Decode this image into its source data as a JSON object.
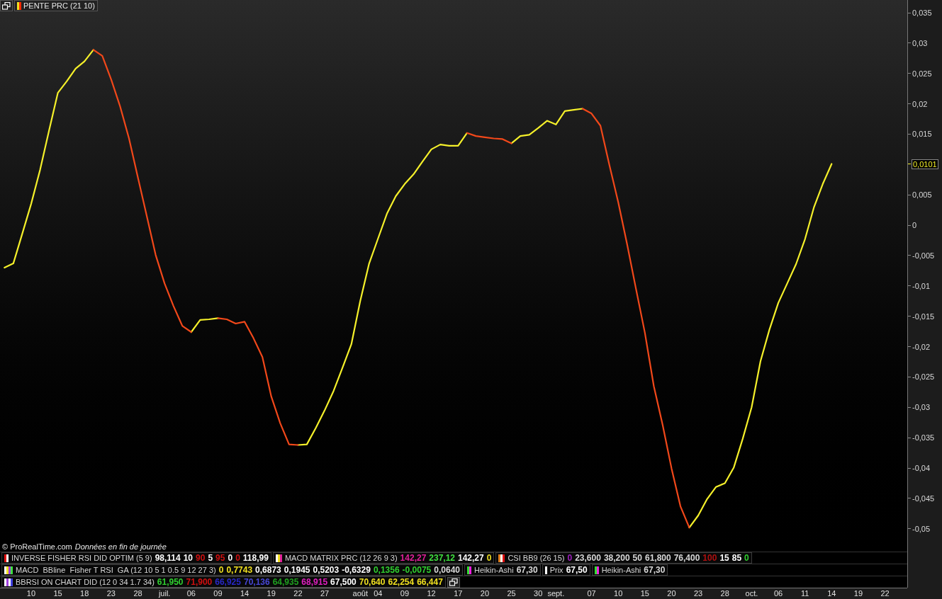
{
  "header": {
    "title": "PENTE PRC (21 10)",
    "stripes": [
      {
        "color": "#f0e020"
      },
      {
        "color": "#ff2a00"
      }
    ]
  },
  "chart_data": {
    "type": "line",
    "ylim": [
      -0.0597,
      0.0371
    ],
    "categories": [
      null,
      null,
      null,
      "10",
      null,
      null,
      "15",
      null,
      null,
      "18",
      null,
      null,
      "23",
      null,
      null,
      "28",
      null,
      null,
      "juil.",
      null,
      null,
      "06",
      null,
      null,
      "09",
      null,
      null,
      "14",
      null,
      null,
      "19",
      null,
      null,
      "22",
      null,
      null,
      "27",
      null,
      null,
      null,
      "août",
      null,
      "04",
      null,
      null,
      "09",
      null,
      null,
      "12",
      null,
      null,
      "17",
      null,
      null,
      "20",
      null,
      null,
      "25",
      null,
      null,
      "30",
      null,
      "sept.",
      null,
      null,
      null,
      "07",
      null,
      null,
      "10",
      null,
      null,
      "15",
      null,
      null,
      "20",
      null,
      null,
      "23",
      null,
      null,
      "28",
      null,
      null,
      "oct.",
      null,
      null,
      "06",
      null,
      null,
      "11",
      null,
      null,
      "14",
      null,
      null,
      "19",
      null,
      null,
      "22",
      null,
      null
    ],
    "series": [
      {
        "color": "#f5f02a",
        "values": [
          -0.007,
          -0.0063,
          -0.0014,
          0.0035,
          0.0091,
          0.0155,
          0.0218,
          0.0237,
          0.0258,
          0.027,
          0.0289,
          null,
          null,
          null,
          null,
          null,
          null,
          null,
          null,
          null,
          null,
          -0.0176,
          -0.0156,
          -0.0155,
          -0.0153,
          null,
          null,
          null,
          null,
          null,
          null,
          null,
          null,
          -0.0362,
          -0.0361,
          -0.0334,
          -0.0305,
          -0.0273,
          -0.0235,
          -0.0196,
          -0.0125,
          -0.0063,
          -0.0022,
          0.0019,
          0.0048,
          0.0068,
          0.0084,
          0.0105,
          0.0125,
          0.0133,
          0.0131,
          0.0131,
          0.0152,
          null,
          null,
          null,
          null,
          0.0135,
          0.0147,
          0.0149,
          0.016,
          0.0172,
          0.0166,
          0.0188,
          0.019,
          0.0192,
          null,
          null,
          null,
          null,
          null,
          null,
          null,
          null,
          null,
          null,
          null,
          -0.0498,
          -0.0478,
          -0.0451,
          -0.0431,
          -0.0425,
          -0.0399,
          -0.0352,
          -0.03,
          -0.0224,
          -0.0172,
          -0.0128,
          -0.0096,
          -0.0064,
          -0.0023,
          0.0029,
          0.0068,
          0.0101,
          null,
          null,
          null,
          null,
          null,
          null,
          null,
          null
        ]
      },
      {
        "color": "#f2481a",
        "values": [
          null,
          null,
          null,
          null,
          null,
          null,
          null,
          null,
          null,
          null,
          0.0289,
          0.0279,
          0.024,
          0.0196,
          0.0143,
          0.0079,
          0.0015,
          -0.0049,
          -0.0096,
          -0.0133,
          -0.0166,
          -0.0176,
          null,
          null,
          -0.0153,
          -0.0155,
          -0.0162,
          -0.0159,
          -0.0186,
          -0.0217,
          -0.0282,
          -0.0326,
          -0.0361,
          -0.0362,
          null,
          null,
          null,
          null,
          null,
          null,
          null,
          null,
          null,
          null,
          null,
          null,
          null,
          null,
          null,
          null,
          null,
          null,
          0.0152,
          0.0147,
          0.0145,
          0.0143,
          0.0142,
          0.0135,
          null,
          null,
          null,
          null,
          null,
          null,
          null,
          0.0192,
          0.0184,
          0.0164,
          0.01,
          0.0038,
          -0.0031,
          -0.0105,
          -0.0177,
          -0.0265,
          -0.0329,
          -0.0401,
          -0.0463,
          -0.0498,
          null,
          null,
          null,
          null,
          null,
          null,
          null,
          null,
          null,
          null,
          null,
          null,
          null,
          null,
          null,
          null,
          null,
          null,
          null,
          null,
          null,
          null,
          null,
          null
        ]
      }
    ],
    "yticks": [
      {
        "value": 0.035,
        "label": "0,035"
      },
      {
        "value": 0.03,
        "label": "0,03"
      },
      {
        "value": 0.025,
        "label": "0,025"
      },
      {
        "value": 0.02,
        "label": "0,02"
      },
      {
        "value": 0.015,
        "label": "0,015"
      },
      {
        "value": 0.005,
        "label": "0,005"
      },
      {
        "value": 0,
        "label": "0"
      },
      {
        "value": -0.005,
        "label": "-0,005"
      },
      {
        "value": -0.01,
        "label": "-0,01"
      },
      {
        "value": -0.015,
        "label": "-0,015"
      },
      {
        "value": -0.02,
        "label": "-0,02"
      },
      {
        "value": -0.025,
        "label": "-0,025"
      },
      {
        "value": -0.03,
        "label": "-0,03"
      },
      {
        "value": -0.035,
        "label": "-0,035"
      },
      {
        "value": -0.04,
        "label": "-0,04"
      },
      {
        "value": -0.045,
        "label": "-0,045"
      },
      {
        "value": -0.05,
        "label": "-0,05"
      }
    ]
  },
  "current_value_tag": "0,0101",
  "source": {
    "copyright": "© ProRealTime.com",
    "note": "Données en fin de journée"
  },
  "legend_rows": [
    [
      {
        "label": "INVERSE FISHER RSI DID OPTIM (5 9)",
        "stripes": [
          {
            "color": "#e01010"
          },
          {
            "color": "#ffffff"
          }
        ],
        "values": [
          {
            "text": "98,114",
            "color": "#ffffff"
          },
          {
            "text": "10",
            "color": "#ffffff"
          },
          {
            "text": "90",
            "color": "#d01010"
          },
          {
            "text": "5",
            "color": "#ffffff"
          },
          {
            "text": "95",
            "color": "#d01010"
          },
          {
            "text": "0",
            "color": "#ffffff"
          },
          {
            "text": "0",
            "color": "#d01010"
          },
          {
            "text": "118,99",
            "color": "#ffffff"
          }
        ]
      },
      {
        "label": "MACD MATRIX PRC (12 26 9 3)",
        "stripes": [
          {
            "color": "#ffffff"
          },
          {
            "color": "#f0e020"
          },
          {
            "color": "#e0209a"
          }
        ],
        "values": [
          {
            "text": "142,27",
            "color": "#e0209a"
          },
          {
            "text": "237,12",
            "color": "#40e040"
          },
          {
            "text": "142,27",
            "color": "#ffffff"
          },
          {
            "text": "0",
            "color": "#f0e020"
          }
        ]
      },
      {
        "label": "CSI BB9 (26 15)",
        "stripes": [
          {
            "color": "#e08020"
          },
          {
            "color": "#ffffff"
          },
          {
            "color": "#e01010"
          }
        ],
        "values": [
          {
            "text": "0",
            "color": "#a020c0"
          },
          {
            "text": "23,600",
            "color": "#d8d8d8"
          },
          {
            "text": "38,200",
            "color": "#d8d8d8"
          },
          {
            "text": "50",
            "color": "#d8d8d8"
          },
          {
            "text": "61,800",
            "color": "#d8d8d8"
          },
          {
            "text": "76,400",
            "color": "#d8d8d8"
          },
          {
            "text": "100",
            "color": "#b01010"
          },
          {
            "text": "15",
            "color": "#ffffff"
          },
          {
            "text": "85",
            "color": "#ffffff"
          },
          {
            "text": "0",
            "color": "#30d030"
          }
        ]
      }
    ],
    [
      {
        "label": "MACD  BBline  Fisher T RSI  GA (12 10 5 1 0.5 9 12 27 3)",
        "stripes": [
          {
            "color": "#ffffff"
          },
          {
            "color": "#f0e020"
          },
          {
            "color": "#a040e0"
          },
          {
            "color": "#40e040"
          }
        ],
        "values": [
          {
            "text": "0",
            "color": "#f0e020"
          },
          {
            "text": "0,7743",
            "color": "#f0e020"
          },
          {
            "text": "0,6873",
            "color": "#ffffff"
          },
          {
            "text": "0,1945",
            "color": "#ffffff"
          },
          {
            "text": "0,5203",
            "color": "#ffffff"
          },
          {
            "text": "-0,6329",
            "color": "#ffffff"
          },
          {
            "text": "0,1356",
            "color": "#30d030"
          },
          {
            "text": "-0,0075",
            "color": "#30d030"
          },
          {
            "text": "0,0640",
            "color": "#d8d8d8"
          }
        ]
      },
      {
        "label": "Heikin-Ashi",
        "stripes": [
          {
            "color": "#30e030"
          },
          {
            "color": "#f020e0"
          }
        ],
        "values": [
          {
            "text": "67,30",
            "color": "#d8d8d8"
          }
        ]
      },
      {
        "label": "Prix",
        "stripes": [
          {
            "color": "#ffffff"
          }
        ],
        "values": [
          {
            "text": "67,50",
            "color": "#ffffff"
          }
        ]
      },
      {
        "label": "Heikin-Ashi",
        "stripes": [
          {
            "color": "#30e030"
          },
          {
            "color": "#f020e0"
          }
        ],
        "values": [
          {
            "text": "67,30",
            "color": "#d8d8d8"
          }
        ]
      }
    ],
    [
      {
        "label": "BBRSI ON CHART DID (12 0 34 1.7 34)",
        "stripes": [
          {
            "color": "#ffffff"
          },
          {
            "color": "#a040e0"
          },
          {
            "color": "#ffffff"
          },
          {
            "color": "#4040e0"
          }
        ],
        "values": [
          {
            "text": "61,950",
            "color": "#30d030"
          },
          {
            "text": "71,900",
            "color": "#d01010"
          },
          {
            "text": "66,925",
            "color": "#2828c8"
          },
          {
            "text": "70,136",
            "color": "#4848d8"
          },
          {
            "text": "64,935",
            "color": "#20a020"
          },
          {
            "text": "68,915",
            "color": "#e020c0"
          },
          {
            "text": "67,500",
            "color": "#ffffff"
          },
          {
            "text": "70,640",
            "color": "#f0e020"
          },
          {
            "text": "62,254",
            "color": "#f0e020"
          },
          {
            "text": "66,447",
            "color": "#f0e020"
          }
        ]
      }
    ]
  ]
}
